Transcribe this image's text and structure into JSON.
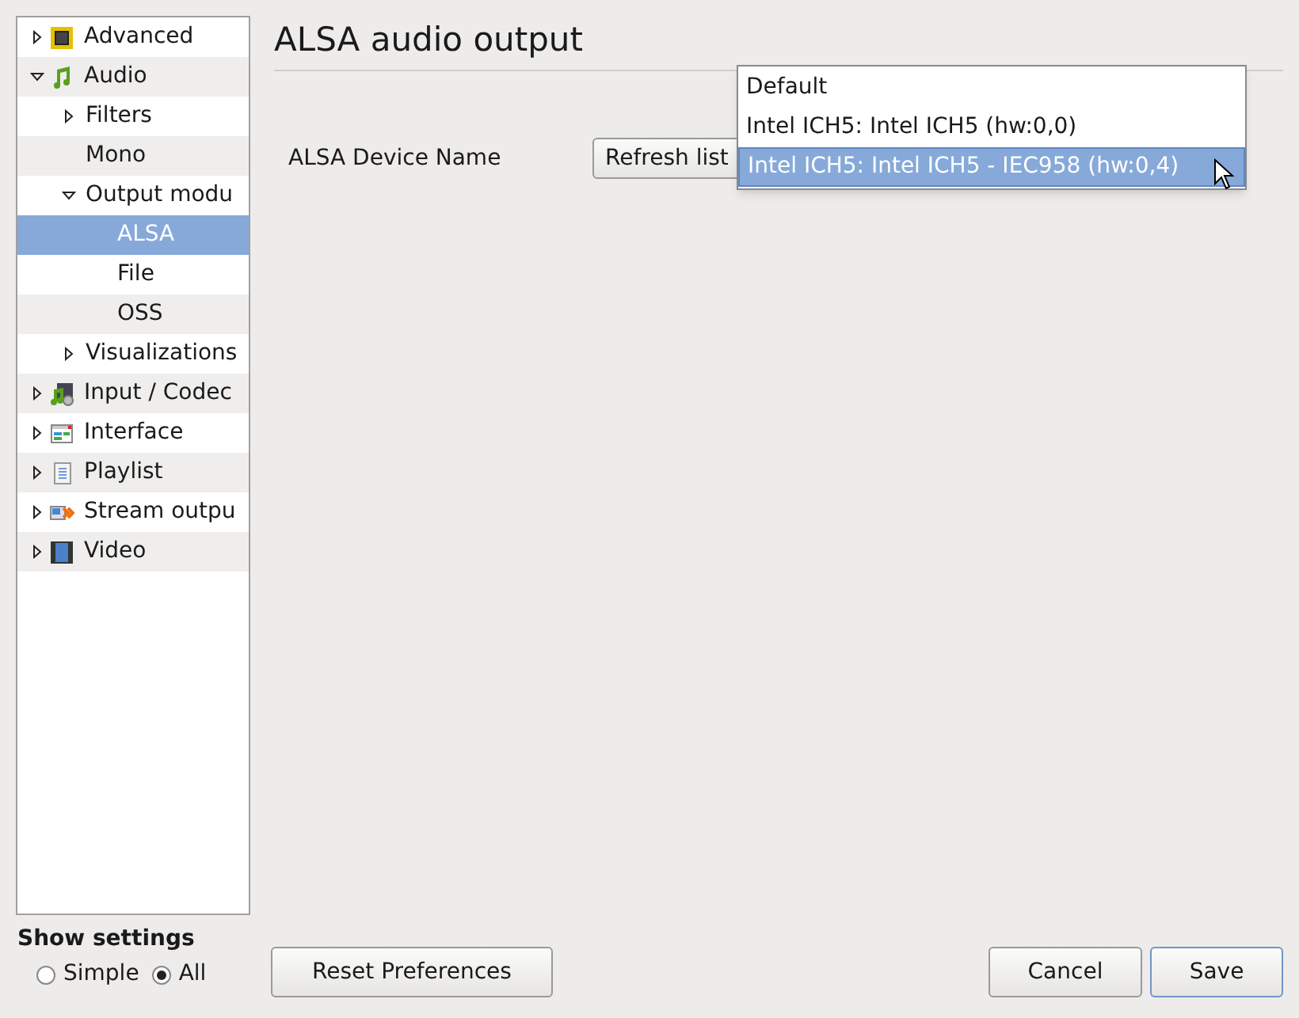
{
  "tree": [
    {
      "label": "Advanced",
      "expandable": true,
      "expanded": false,
      "selected": false
    },
    {
      "label": "Audio",
      "expandable": true,
      "expanded": true,
      "selected": false,
      "children": [
        {
          "label": "Filters",
          "expandable": true,
          "expanded": false,
          "selected": false
        },
        {
          "label": "Mono",
          "expandable": false,
          "expanded": false,
          "selected": false
        },
        {
          "label": "Output modu",
          "expandable": true,
          "expanded": true,
          "selected": false,
          "children": [
            {
              "label": "ALSA",
              "expandable": false,
              "expanded": false,
              "selected": true
            },
            {
              "label": "File",
              "expandable": false,
              "expanded": false,
              "selected": false
            },
            {
              "label": "OSS",
              "expandable": false,
              "expanded": false,
              "selected": false
            }
          ]
        },
        {
          "label": "Visualizations",
          "expandable": true,
          "expanded": false,
          "selected": false
        }
      ]
    },
    {
      "label": "Input / Codec",
      "expandable": true,
      "expanded": false,
      "selected": false
    },
    {
      "label": "Interface",
      "expandable": true,
      "expanded": false,
      "selected": false
    },
    {
      "label": "Playlist",
      "expandable": true,
      "expanded": false,
      "selected": false
    },
    {
      "label": "Stream outpu",
      "expandable": true,
      "expanded": false,
      "selected": false
    },
    {
      "label": "Video",
      "expandable": true,
      "expanded": false,
      "selected": false
    }
  ],
  "panel": {
    "title": "ALSA audio output",
    "device_label": "ALSA Device Name",
    "refresh_button": "Refresh list",
    "device_options": [
      {
        "label": "Default",
        "selected": false
      },
      {
        "label": "Intel ICH5: Intel ICH5 (hw:0,0)",
        "selected": false
      },
      {
        "label": "Intel ICH5: Intel ICH5 - IEC958 (hw:0,4)",
        "selected": true
      }
    ]
  },
  "show_settings": {
    "title": "Show settings",
    "options": [
      {
        "label": "Simple",
        "selected": false
      },
      {
        "label": "All",
        "selected": true
      }
    ]
  },
  "buttons": {
    "reset": "Reset Preferences",
    "cancel": "Cancel",
    "save": "Save"
  }
}
